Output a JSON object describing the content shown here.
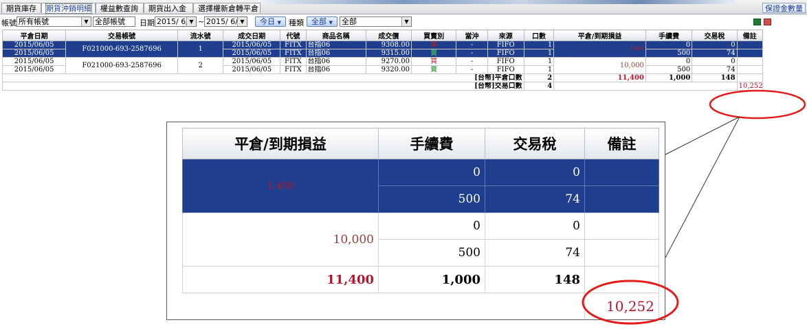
{
  "tabs": [
    {
      "label": "期貨庫存",
      "active": false
    },
    {
      "label": "期貨沖銷明細",
      "active": true
    },
    {
      "label": "權益數查詢",
      "active": false
    },
    {
      "label": "期貨出入金",
      "active": false
    },
    {
      "label": "選擇權新倉轉平倉",
      "active": false
    }
  ],
  "side_button": "保證金數量",
  "filter": {
    "account_label": "帳號",
    "account_value": "所有帳號",
    "account_name": "全部帳號",
    "date_label": "日期",
    "date_from": "2015/ 6/ 5",
    "date_sep": "~",
    "date_to": "2015/ 6/ 5",
    "today_button": "今日",
    "type_label": "種類",
    "type_button": "全部",
    "type_value": "全部"
  },
  "columns": [
    "平倉日期",
    "交易帳號",
    "流水號",
    "成交日期",
    "代號",
    "商品名稱",
    "成交價",
    "買賣別",
    "當沖",
    "來源",
    "口數",
    "平倉/到期損益",
    "手續費",
    "交易稅",
    "備註"
  ],
  "groups": [
    {
      "close_date": [
        "2015/06/05",
        "2015/06/05"
      ],
      "account": "F021000-693-2587696",
      "serial": "1",
      "selected": true,
      "pnl": "1,400",
      "rows": [
        {
          "trade_date": "2015/06/05",
          "code": "FITX",
          "product": "台指06",
          "price": "9308.00",
          "side": "買",
          "daytrade": "-",
          "source": "FIFO",
          "qty": "1",
          "fee": "0",
          "tax": "0"
        },
        {
          "trade_date": "2015/06/05",
          "code": "FITX",
          "product": "台指06",
          "price": "9315.00",
          "side": "賣",
          "daytrade": "-",
          "source": "FIFO",
          "qty": "1",
          "fee": "500",
          "tax": "74"
        }
      ]
    },
    {
      "close_date": [
        "2015/06/05",
        "2015/06/05"
      ],
      "account": "F021000-693-2587696",
      "serial": "2",
      "selected": false,
      "pnl": "10,000",
      "rows": [
        {
          "trade_date": "2015/06/05",
          "code": "FITX",
          "product": "台指06",
          "price": "9270.00",
          "side": "買",
          "daytrade": "-",
          "source": "FIFO",
          "qty": "1",
          "fee": "0",
          "tax": "0"
        },
        {
          "trade_date": "2015/06/05",
          "code": "FITX",
          "product": "台指06",
          "price": "9320.00",
          "side": "賣",
          "daytrade": "-",
          "source": "FIFO",
          "qty": "1",
          "fee": "500",
          "tax": "74"
        }
      ]
    }
  ],
  "summary": {
    "close_qty_label": "[台幣]平倉口數",
    "close_qty": "2",
    "total_pnl": "11,400",
    "total_fee": "1,000",
    "total_tax": "148",
    "trade_qty_label": "[台幣]交易口數",
    "trade_qty": "4",
    "net_total": "10,252"
  },
  "zoom": {
    "headers": [
      "平倉/到期損益",
      "手續費",
      "交易稅",
      "備註"
    ]
  },
  "colors": {
    "selection": "#1f3f8e",
    "highlight_circle": "#e21b1b",
    "pnl_text": "#b3172d",
    "sell": "#1d8a2a",
    "buy": "#cc1a1a"
  },
  "icons": [
    "excel-icon",
    "print-icon"
  ]
}
